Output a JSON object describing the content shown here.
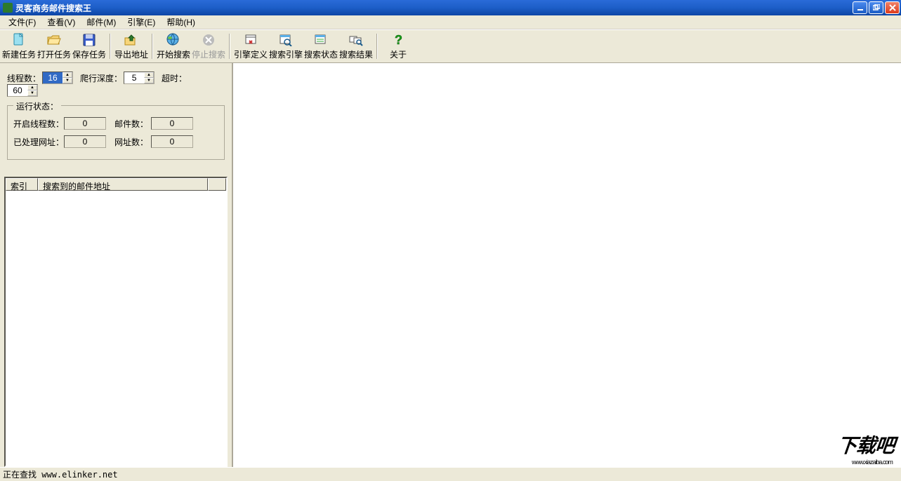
{
  "window": {
    "title": "灵客商务邮件搜索王"
  },
  "menu": {
    "file": "文件(F)",
    "view": "查看(V)",
    "mail": "邮件(M)",
    "engine": "引擎(E)",
    "help": "帮助(H)"
  },
  "toolbar": {
    "new_task": "新建任务",
    "open_task": "打开任务",
    "save_task": "保存任务",
    "export_addr": "导出地址",
    "start_search": "开始搜索",
    "stop_search": "停止搜索",
    "engine_define": "引擎定义",
    "search_engine": "搜索引擎",
    "search_status": "搜索状态",
    "search_result": "搜索结果",
    "about": "关于"
  },
  "settings": {
    "threads_label": "线程数：",
    "threads_value": "16",
    "depth_label": "爬行深度：",
    "depth_value": "5",
    "timeout_label": "超时：",
    "timeout_value": "60"
  },
  "status_group": {
    "legend": "运行状态：",
    "open_threads_label": "开启线程数：",
    "open_threads_value": "0",
    "mail_count_label": "邮件数：",
    "mail_count_value": "0",
    "processed_url_label": "已处理网址：",
    "processed_url_value": "0",
    "url_count_label": "网址数：",
    "url_count_value": "0"
  },
  "list": {
    "col_index": "索引",
    "col_addr": "搜索到的邮件地址"
  },
  "statusbar": {
    "text": "正在查找 www.elinker.net"
  },
  "watermark": {
    "text": "下载吧",
    "sub": "www.xiazaiba.com"
  }
}
